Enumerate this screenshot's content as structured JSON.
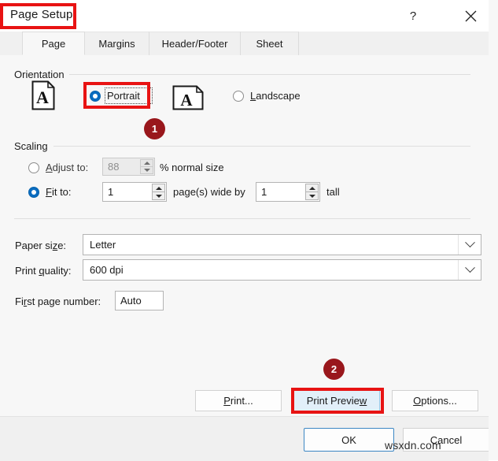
{
  "window": {
    "title": "Page Setup",
    "help_icon": "question-mark-icon",
    "help_label": "?",
    "close_icon": "close-icon"
  },
  "tabs": [
    {
      "label": "Page",
      "selected": true
    },
    {
      "label": "Margins",
      "selected": false
    },
    {
      "label": "Header/Footer",
      "selected": false
    },
    {
      "label": "Sheet",
      "selected": false
    }
  ],
  "orientation": {
    "group_label": "Orientation",
    "portrait": {
      "label": "Portrait",
      "selected": true,
      "icon": "portrait-page-icon",
      "icon_letter": "A"
    },
    "landscape": {
      "label": "Landscape",
      "selected": false,
      "icon": "landscape-page-icon",
      "icon_letter": "A"
    }
  },
  "scaling": {
    "group_label": "Scaling",
    "adjust_to": {
      "label": "Adjust to:",
      "value": "88",
      "suffix": "% normal size",
      "selected": false,
      "enabled": false
    },
    "fit_to": {
      "label": "Fit to:",
      "wide_value": "1",
      "middle_text": "page(s) wide by",
      "tall_value": "1",
      "tall_text": "tall",
      "selected": true,
      "enabled": true
    }
  },
  "fields": {
    "paper_size": {
      "label": "Paper size:",
      "value": "Letter"
    },
    "print_quality": {
      "label": "Print quality:",
      "value": "600 dpi"
    },
    "first_page_number": {
      "label": "First page number:",
      "value": "Auto"
    }
  },
  "buttons": {
    "print": "Print...",
    "print_preview": "Print Preview",
    "options": "Options...",
    "ok": "OK",
    "cancel": "Cancel"
  },
  "annotations": {
    "badge_one": "1",
    "badge_two": "2",
    "highlight_color": "#e81313",
    "badge_color": "#99171c"
  },
  "watermark": "wsxdn.com"
}
